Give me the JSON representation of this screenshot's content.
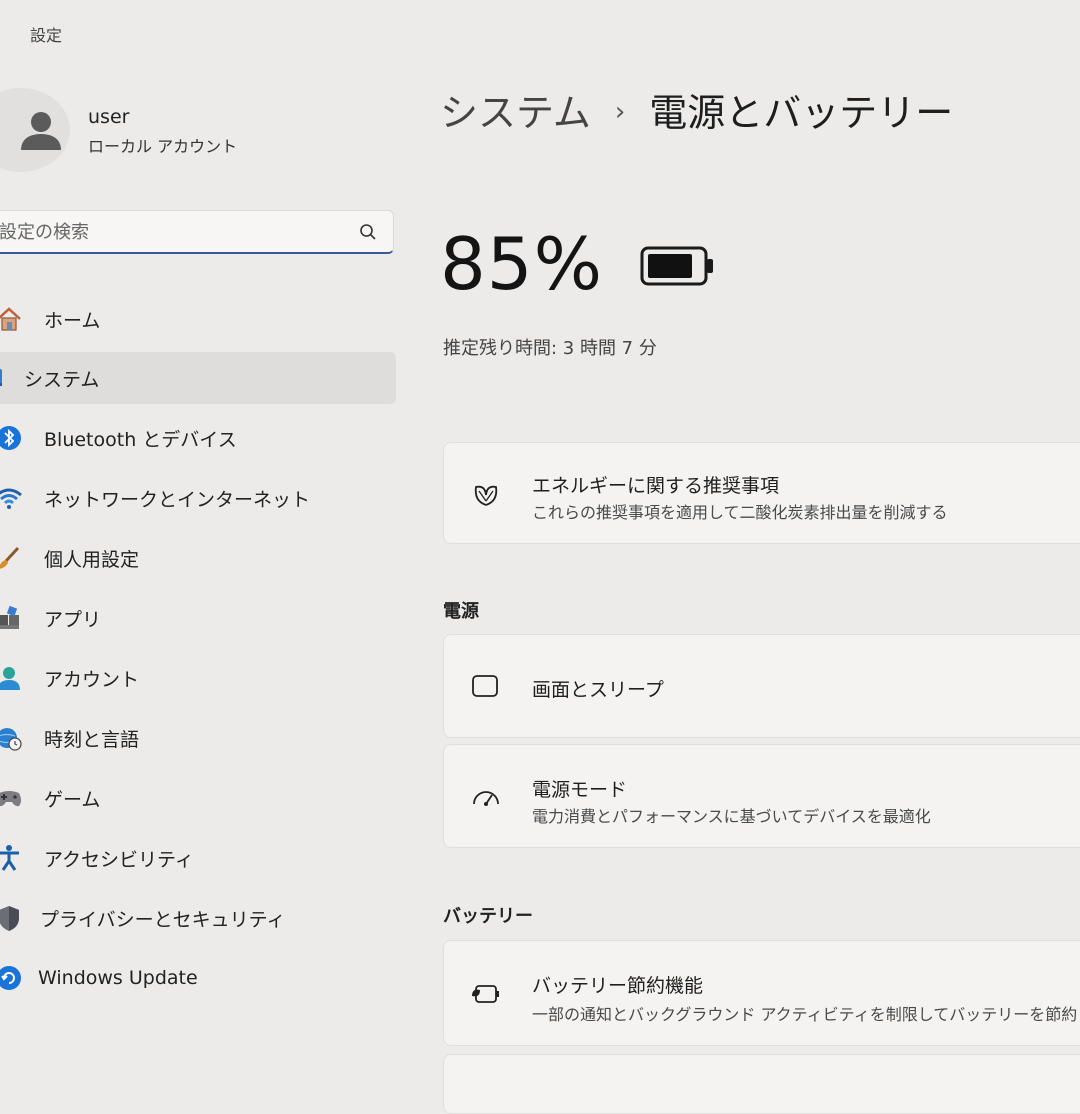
{
  "window": {
    "title": "設定"
  },
  "profile": {
    "name": "user",
    "account_type": "ローカル アカウント"
  },
  "search": {
    "placeholder": "設定の検索"
  },
  "sidebar": {
    "items": [
      {
        "label": "ホーム",
        "icon": "home-icon"
      },
      {
        "label": "システム",
        "icon": "system-icon",
        "active": true
      },
      {
        "label": "Bluetooth とデバイス",
        "icon": "bluetooth-icon"
      },
      {
        "label": "ネットワークとインターネット",
        "icon": "wifi-icon"
      },
      {
        "label": "個人用設定",
        "icon": "brush-icon"
      },
      {
        "label": "アプリ",
        "icon": "apps-icon"
      },
      {
        "label": "アカウント",
        "icon": "account-icon"
      },
      {
        "label": "時刻と言語",
        "icon": "globe-clock-icon"
      },
      {
        "label": "ゲーム",
        "icon": "gamepad-icon"
      },
      {
        "label": "アクセシビリティ",
        "icon": "accessibility-icon"
      },
      {
        "label": "プライバシーとセキュリティ",
        "icon": "shield-icon"
      },
      {
        "label": "Windows Update",
        "icon": "update-icon"
      }
    ]
  },
  "breadcrumb": {
    "parent": "システム",
    "separator": "›",
    "current": "電源とバッテリー"
  },
  "battery": {
    "percent_label": "85%",
    "level": 0.85,
    "remaining": "推定残り時間: 3 時間 7 分"
  },
  "energy_card": {
    "title": "エネルギーに関する推奨事項",
    "desc": "これらの推奨事項を適用して二酸化炭素排出量を削減する",
    "icon": "leaf-icon"
  },
  "power_section": {
    "title": "電源",
    "screen_sleep": {
      "title": "画面とスリープ",
      "icon": "screen-sleep-icon"
    },
    "power_mode": {
      "title": "電源モード",
      "desc": "電力消費とパフォーマンスに基づいてデバイスを最適化",
      "icon": "gauge-icon"
    }
  },
  "battery_section": {
    "title": "バッテリー",
    "saver": {
      "title": "バッテリー節約機能",
      "desc": "一部の通知とバックグラウンド アクティビティを制限してバッテリーを節約",
      "icon": "battery-saver-icon"
    }
  },
  "colors": {
    "accent": "#3c5a9a",
    "background": "#ecebea",
    "card": "#f4f3f2"
  }
}
